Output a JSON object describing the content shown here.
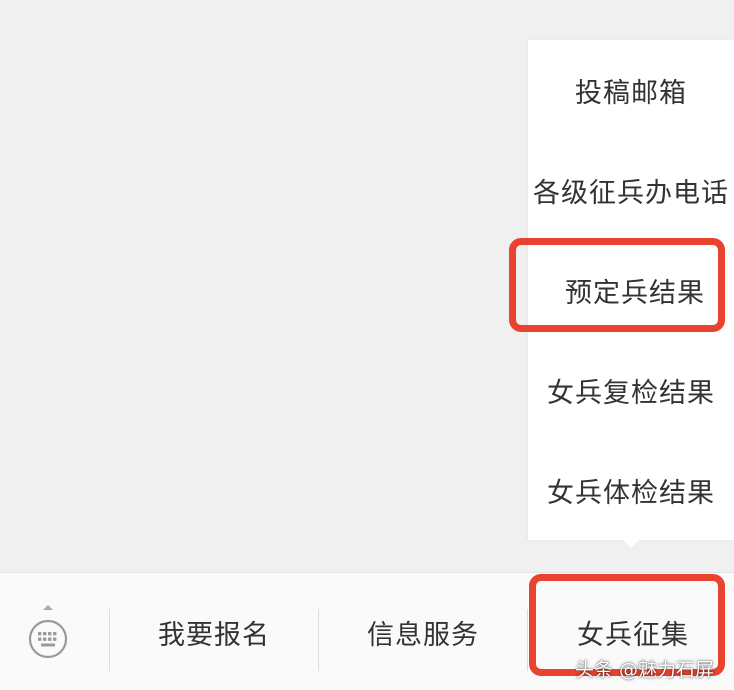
{
  "submenu": {
    "items": [
      {
        "label": "投稿邮箱"
      },
      {
        "label": "各级征兵办电话"
      },
      {
        "label": "预定兵结果"
      },
      {
        "label": "女兵复检结果"
      },
      {
        "label": "女兵体检结果"
      }
    ]
  },
  "menubar": {
    "keyboard_icon": "keyboard-icon",
    "buttons": [
      {
        "label": "我要报名"
      },
      {
        "label": "信息服务"
      },
      {
        "label": "女兵征集"
      }
    ]
  },
  "highlights": {
    "color": "#e8432f",
    "targets": [
      "预定兵结果",
      "女兵征集"
    ]
  },
  "watermark": "头条 @魅力石屏"
}
